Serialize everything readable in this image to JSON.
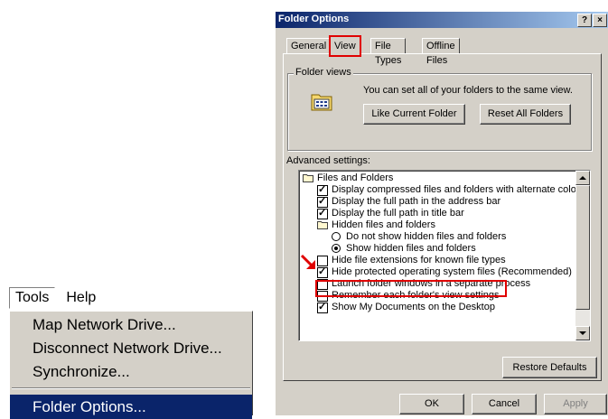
{
  "menubar": {
    "tools": "Tools",
    "help": "Help"
  },
  "tools_menu": {
    "items": [
      "Map Network Drive...",
      "Disconnect Network Drive...",
      "Synchronize...",
      "Folder Options..."
    ],
    "selected": "Folder Options..."
  },
  "dialog": {
    "title": "Folder Options",
    "help_btn": "?",
    "close_btn": "×",
    "tabs": [
      "General",
      "View",
      "File Types",
      "Offline Files"
    ],
    "active_tab": "View",
    "folder_views": {
      "label": "Folder views",
      "text": "You can set all of your folders to the same view.",
      "like_current": "Like Current Folder",
      "reset_all": "Reset All Folders"
    },
    "advanced_label": "Advanced settings:",
    "tree": [
      {
        "type": "folder",
        "level": 0,
        "label": "Files and Folders"
      },
      {
        "type": "checkbox",
        "level": 1,
        "checked": true,
        "label": "Display compressed files and folders with alternate color"
      },
      {
        "type": "checkbox",
        "level": 1,
        "checked": true,
        "label": "Display the full path in the address bar"
      },
      {
        "type": "checkbox",
        "level": 1,
        "checked": true,
        "label": "Display the full path in title bar"
      },
      {
        "type": "folder",
        "level": 1,
        "label": "Hidden files and folders"
      },
      {
        "type": "radio",
        "level": 2,
        "checked": false,
        "label": "Do not show hidden files and folders"
      },
      {
        "type": "radio",
        "level": 2,
        "checked": true,
        "label": "Show hidden files and folders"
      },
      {
        "type": "checkbox",
        "level": 1,
        "checked": false,
        "label": "Hide file extensions for known file types"
      },
      {
        "type": "checkbox",
        "level": 1,
        "checked": true,
        "label": "Hide protected operating system files (Recommended)"
      },
      {
        "type": "checkbox",
        "level": 1,
        "checked": false,
        "label": "Launch folder windows in a separate process"
      },
      {
        "type": "checkbox",
        "level": 1,
        "checked": false,
        "label": "Remember each folder's view settings"
      },
      {
        "type": "checkbox",
        "level": 1,
        "checked": true,
        "label": "Show My Documents on the Desktop"
      }
    ],
    "restore_defaults": "Restore Defaults",
    "ok": "OK",
    "cancel": "Cancel",
    "apply": "Apply"
  },
  "colors": {
    "highlight": "#0a246a",
    "callout": "#e00000",
    "face": "#d4d0c8"
  }
}
